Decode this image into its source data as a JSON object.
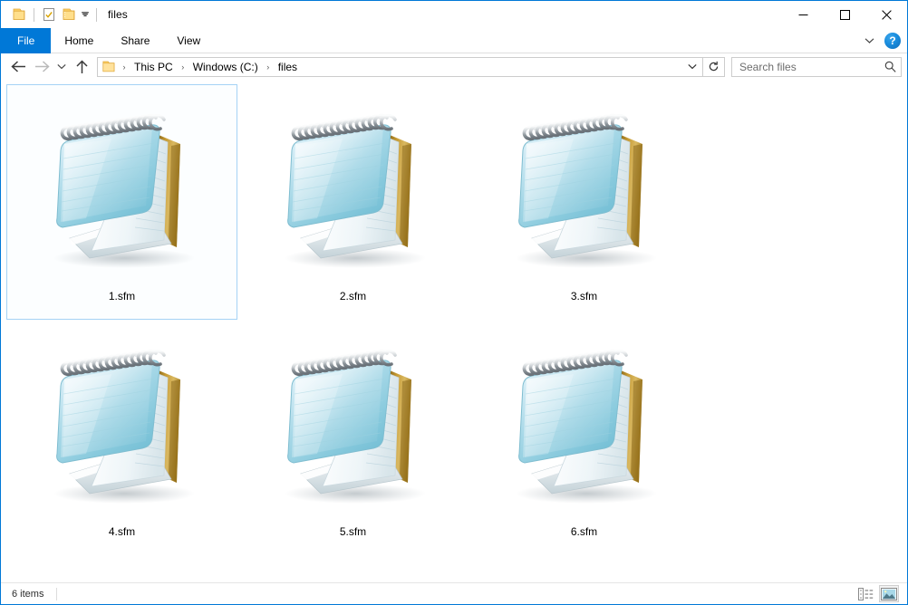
{
  "window": {
    "title": "files",
    "quick_access": [
      {
        "name": "folder-icon",
        "label": "Folder"
      },
      {
        "name": "properties-icon",
        "label": "Properties"
      },
      {
        "name": "new-folder-icon",
        "label": "New folder"
      },
      {
        "name": "chevron-down-icon",
        "label": "Customize Quick Access Toolbar"
      }
    ],
    "controls": {
      "minimize": "—",
      "maximize": "☐",
      "close": "✕"
    }
  },
  "ribbon": {
    "tabs": [
      {
        "label": "File",
        "active": true
      },
      {
        "label": "Home",
        "active": false
      },
      {
        "label": "Share",
        "active": false
      },
      {
        "label": "View",
        "active": false
      }
    ],
    "collapse_icon": "chevron-down-icon",
    "help_label": "?"
  },
  "navigation": {
    "back_icon": "arrow-left-icon",
    "forward_icon": "arrow-right-icon",
    "recent_icon": "chevron-down-icon",
    "up_icon": "arrow-up-icon",
    "breadcrumb": [
      {
        "label": "This PC"
      },
      {
        "label": "Windows (C:)"
      },
      {
        "label": "files"
      }
    ],
    "breadcrumb_separator": "›",
    "address_caret_icon": "chevron-down-icon",
    "refresh_icon": "refresh-icon"
  },
  "search": {
    "placeholder": "Search files",
    "value": "",
    "icon": "search-icon"
  },
  "files": [
    {
      "name": "1.sfm",
      "selected": true
    },
    {
      "name": "2.sfm",
      "selected": false
    },
    {
      "name": "3.sfm",
      "selected": false
    },
    {
      "name": "4.sfm",
      "selected": false
    },
    {
      "name": "5.sfm",
      "selected": false
    },
    {
      "name": "6.sfm",
      "selected": false
    }
  ],
  "status": {
    "item_count": "6 items",
    "view_details_icon": "details-view-icon",
    "view_large_icons_icon": "large-icons-view-icon",
    "active_view": "large-icons"
  },
  "colors": {
    "accent": "#0078d7",
    "selection_border": "#a5d3f5",
    "selection_fill": "#fcfeff",
    "folder_yellow": "#ffd067",
    "notepad_cover": "#7fc6dd",
    "notepad_back": "#b8902f"
  }
}
